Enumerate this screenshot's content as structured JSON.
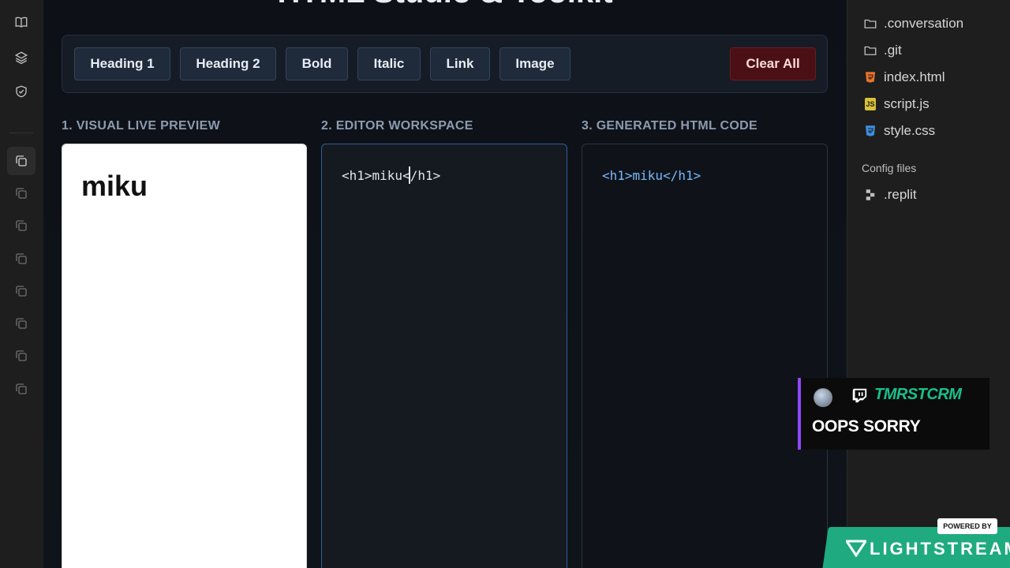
{
  "app": {
    "title": "HTML Studio & Toolkit"
  },
  "toolbar": {
    "heading1": "Heading 1",
    "heading2": "Heading 2",
    "bold": "Bold",
    "italic": "Italic",
    "link": "Link",
    "image": "Image",
    "clear_all": "Clear All"
  },
  "columns": {
    "preview_label": "1. VISUAL LIVE PREVIEW",
    "editor_label": "2. EDITOR WORKSPACE",
    "output_label": "3. GENERATED HTML CODE"
  },
  "preview": {
    "heading_text": "miku"
  },
  "editor": {
    "content": "<h1>miku</h1>"
  },
  "output": {
    "content": "<h1>miku</h1>"
  },
  "files": {
    "items": [
      {
        "name": ".conversation",
        "icon": "folder-icon"
      },
      {
        "name": ".git",
        "icon": "folder-icon"
      },
      {
        "name": "index.html",
        "icon": "html-file-icon"
      },
      {
        "name": "script.js",
        "icon": "js-file-icon"
      },
      {
        "name": "style.css",
        "icon": "css-file-icon"
      }
    ],
    "config_section_label": "Config files",
    "config_items": [
      {
        "name": ".replit",
        "icon": "replit-icon"
      }
    ]
  },
  "chat": {
    "username": "TMRSTCRM",
    "message": "OOPS SORRY"
  },
  "branding": {
    "powered_by": "POWERED BY",
    "name": "LIGHTSTREAM"
  },
  "colors": {
    "accent_blue": "#2d5e9c",
    "danger": "#4a1016",
    "twitch_purple": "#9146ff",
    "lightstream_green": "#1fab7f",
    "chat_user": "#19c08a"
  }
}
